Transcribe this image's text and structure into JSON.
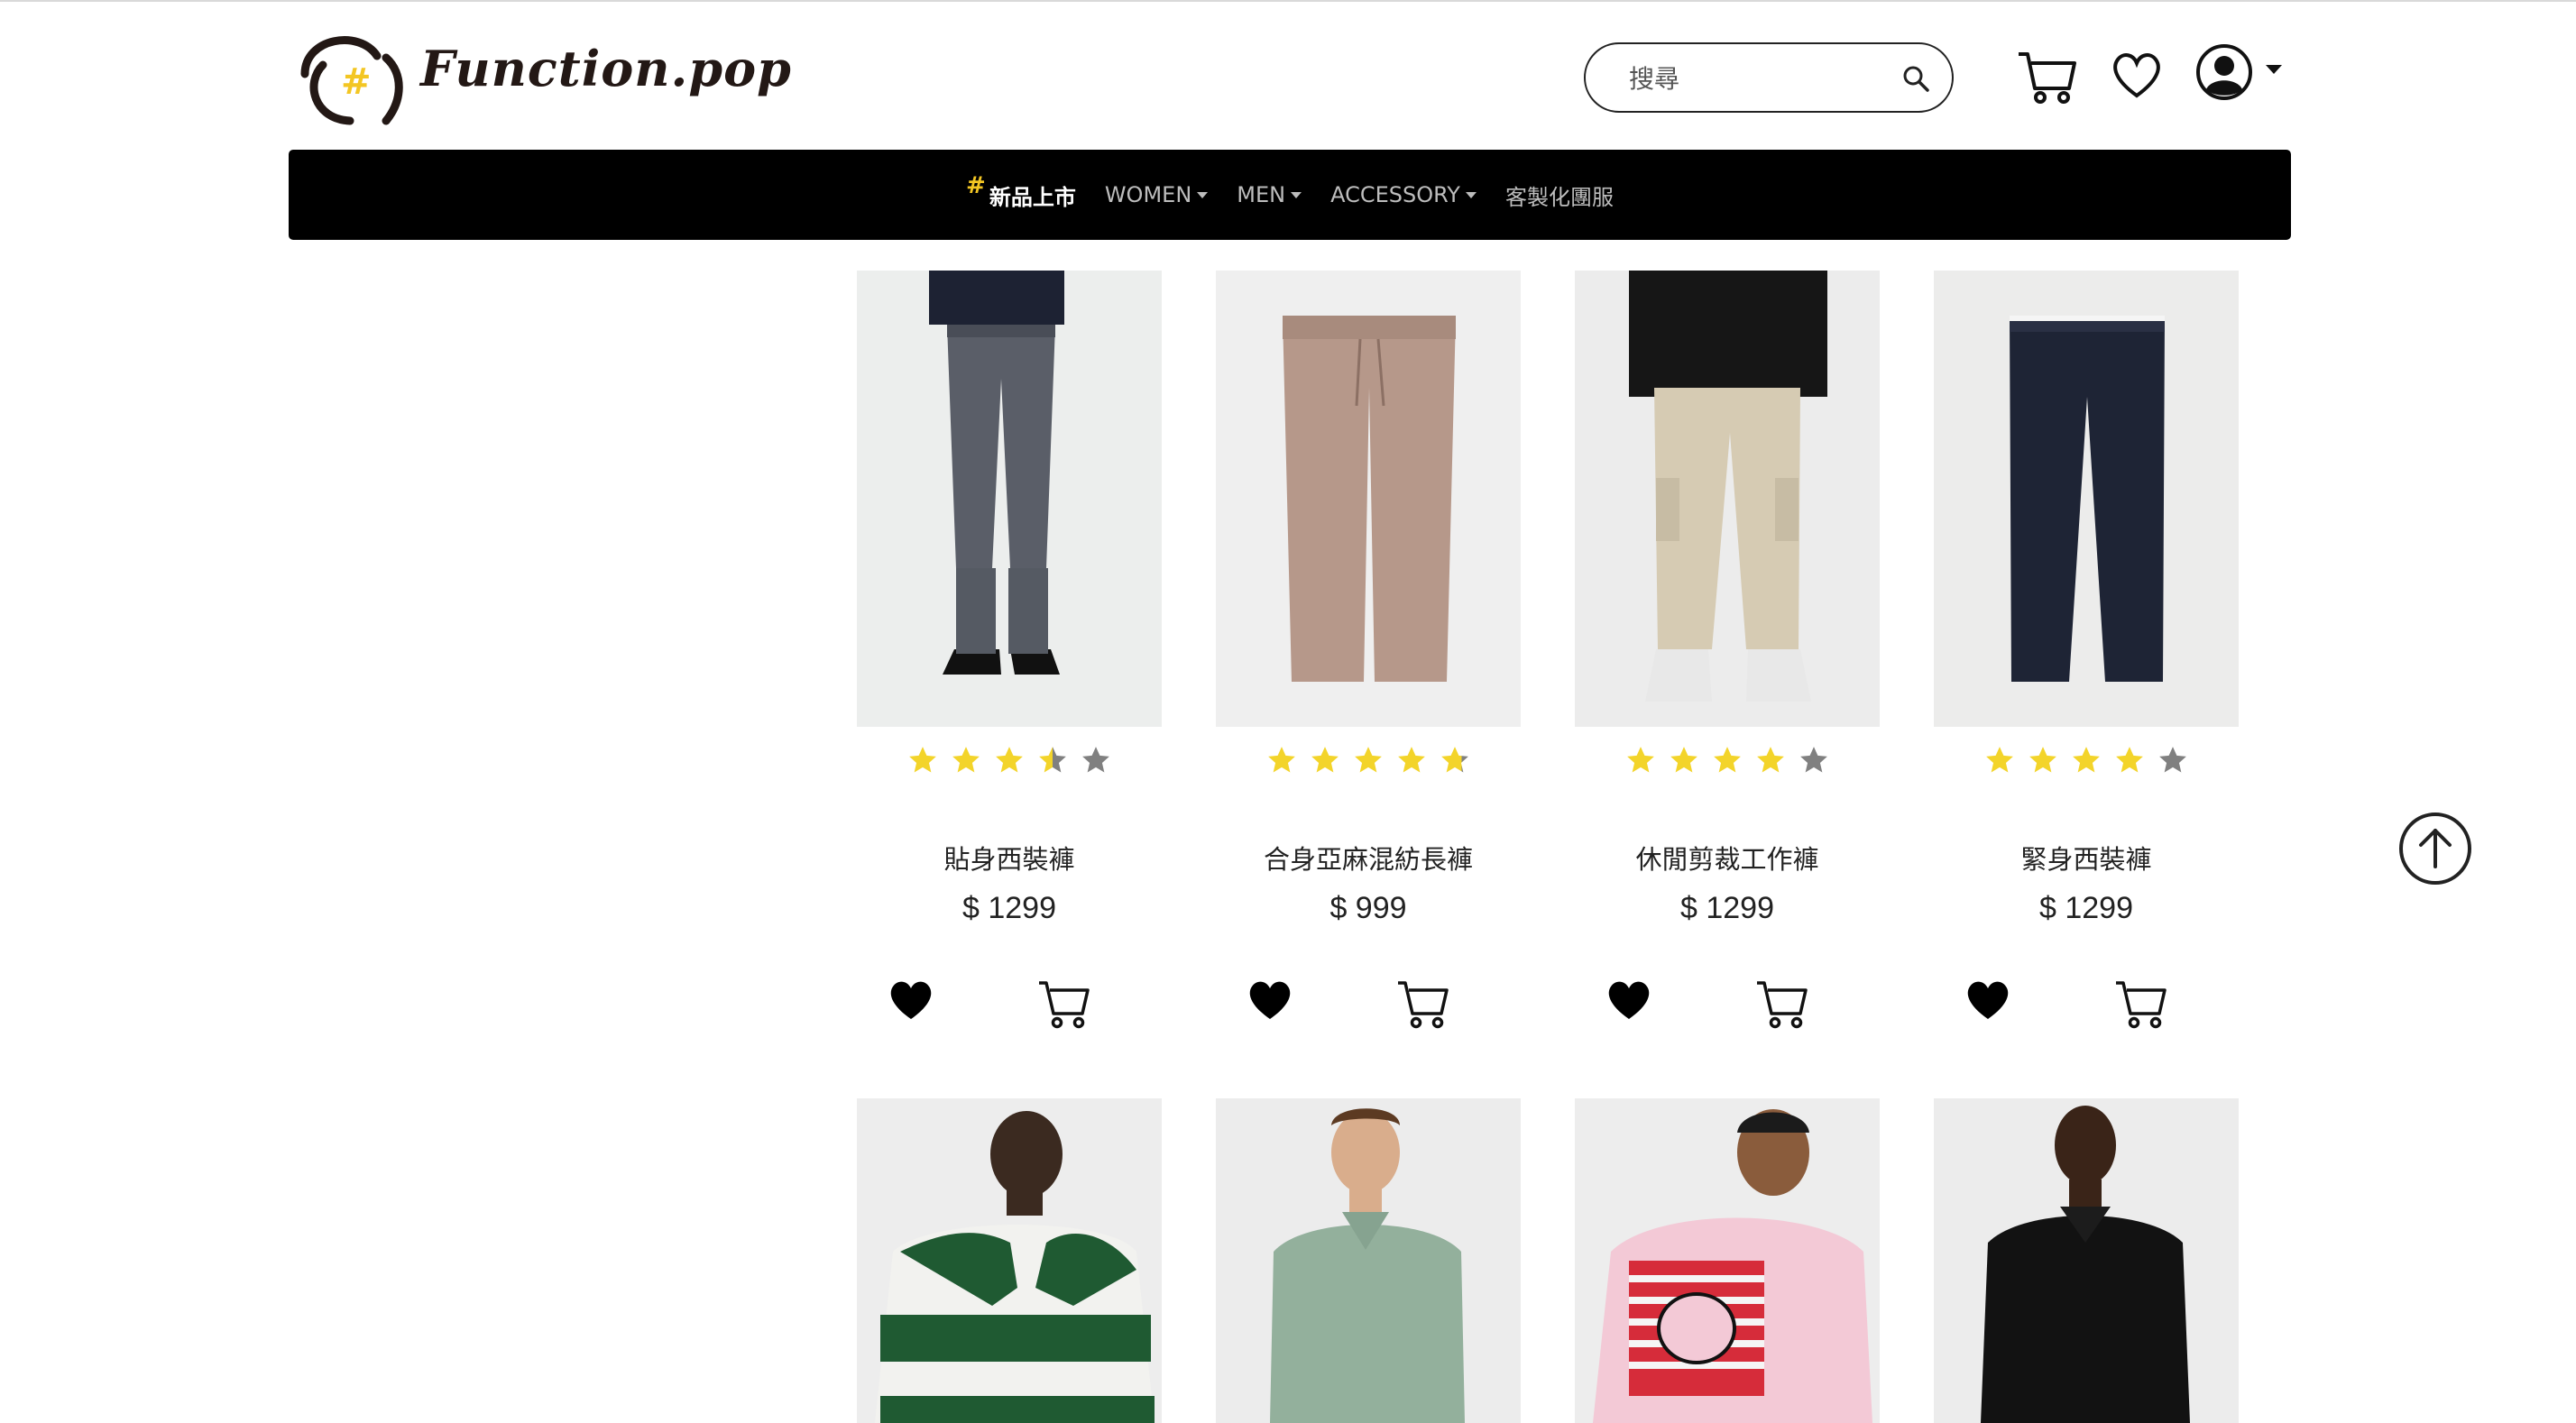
{
  "brand": {
    "name": "Function.pop",
    "logo_mark": "#"
  },
  "search": {
    "placeholder": "搜尋"
  },
  "header_icons": [
    "cart-icon",
    "heart-icon",
    "user-icon",
    "caret-down-icon"
  ],
  "nav": {
    "items": [
      {
        "label": "新品上市",
        "prefix": "#",
        "dropdown": false,
        "active": true
      },
      {
        "label": "WOMEN",
        "dropdown": true,
        "active": false
      },
      {
        "label": "MEN",
        "dropdown": true,
        "active": false
      },
      {
        "label": "ACCESSORY",
        "dropdown": true,
        "active": false
      },
      {
        "label": "客製化團服",
        "dropdown": false,
        "active": false
      }
    ]
  },
  "colors": {
    "star_on": "#f3d42a",
    "star_off": "#808080",
    "nav_bg": "#000000",
    "accent": "#f3c623"
  },
  "products": [
    {
      "name": "貼身西裝褲",
      "price": "$ 1299",
      "rating": 3.5,
      "image": "gray-slim-trousers"
    },
    {
      "name": "合身亞麻混紡長褲",
      "price": "$ 999",
      "rating": 4.5,
      "image": "beige-linen-trousers"
    },
    {
      "name": "休閒剪裁工作褲",
      "price": "$ 1299",
      "rating": 4,
      "image": "khaki-cargo-pants"
    },
    {
      "name": "緊身西裝褲",
      "price": "$ 1299",
      "rating": 4,
      "image": "navy-slim-trousers"
    }
  ],
  "products_row2": [
    {
      "image": "green-white-rugby-shirt"
    },
    {
      "image": "sage-polo-shirt"
    },
    {
      "image": "pink-graphic-tee"
    },
    {
      "image": "black-polo-shirt"
    }
  ]
}
